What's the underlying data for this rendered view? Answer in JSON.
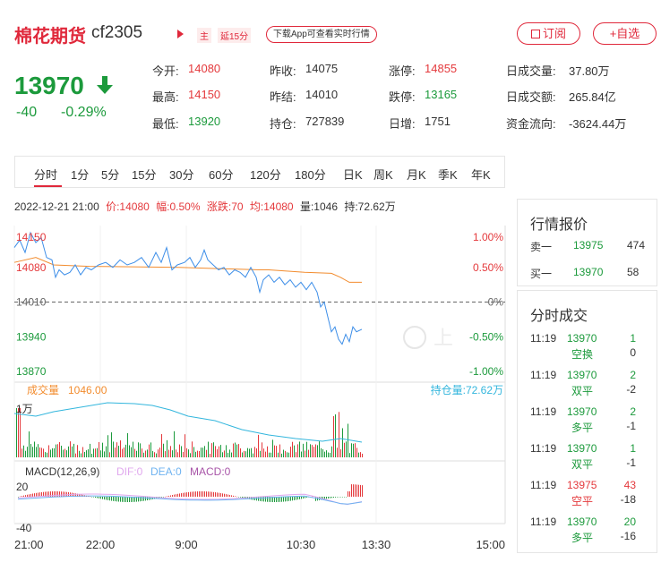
{
  "header": {
    "name": "棉花期货",
    "code": "cf2305",
    "main_tag": "主",
    "delay_tag": "延15分",
    "download": "下载App可查看实时行情",
    "subscribe": "订阅",
    "watch": "+自选"
  },
  "quote": {
    "price": "13970",
    "change": "-40",
    "change_pct": "-0.29%",
    "fields": [
      {
        "label": "今开:",
        "value": "14080",
        "tone": "red"
      },
      {
        "label": "昨收:",
        "value": "14075",
        "tone": "normal"
      },
      {
        "label": "涨停:",
        "value": "14855",
        "tone": "red"
      },
      {
        "label": "日成交量:",
        "value": "37.80万",
        "tone": "normal"
      },
      {
        "label": "最高:",
        "value": "14150",
        "tone": "red"
      },
      {
        "label": "昨结:",
        "value": "14010",
        "tone": "normal"
      },
      {
        "label": "跌停:",
        "value": "13165",
        "tone": "green"
      },
      {
        "label": "日成交额:",
        "value": "265.84亿",
        "tone": "normal"
      },
      {
        "label": "最低:",
        "value": "13920",
        "tone": "green"
      },
      {
        "label": "持仓:",
        "value": "727839",
        "tone": "normal"
      },
      {
        "label": "日增:",
        "value": "1751",
        "tone": "normal"
      },
      {
        "label": "资金流向:",
        "value": "-3624.44万",
        "tone": "normal"
      }
    ]
  },
  "tabs": [
    "分时",
    "1分",
    "5分",
    "15分",
    "30分",
    "60分",
    "120分",
    "180分",
    "日K",
    "周K",
    "月K",
    "季K",
    "年K"
  ],
  "active_tab": "分时",
  "info_line": {
    "datetime": "2022-12-21 21:00",
    "price": "价:14080",
    "amplitude": "幅:0.50%",
    "change": "涨跌:70",
    "avg": "均:14080",
    "volume": "量:1046",
    "open_interest": "持:72.62万"
  },
  "chart": {
    "price_ticks": [
      "14150",
      "14080",
      "14010",
      "13940",
      "13870"
    ],
    "pct_ticks": [
      "1.00%",
      "0.50%",
      "0%",
      "-0.50%",
      "-1.00%"
    ],
    "volume_label": "成交量",
    "volume_value": "1046.00",
    "oi_label": "持仓量:72.62万",
    "volume_tick": "1万",
    "macd_label": "MACD(12,26,9)",
    "dif": "DIF:0",
    "dea": "DEA:0",
    "macd": "MACD:0",
    "macd_top": "20",
    "macd_bottom": "-40",
    "time_ticks": [
      "21:00",
      "22:00",
      "9:00",
      "10:30",
      "13:30",
      "15:00"
    ],
    "colors": {
      "price": "#3d8ee8",
      "avg": "#f28c2e",
      "oi": "#33b6dd",
      "up": "#e4393c",
      "down": "#1c9a3c",
      "dif": "#e0a8ee",
      "dea": "#6fb3f0",
      "macd": "#a855a8"
    }
  },
  "order_book": {
    "title": "行情报价",
    "rows": [
      {
        "side": "卖一",
        "price": "13975",
        "qty": "474"
      },
      {
        "side": "买一",
        "price": "13970",
        "qty": "58"
      }
    ]
  },
  "trades": {
    "title": "分时成交",
    "rows": [
      {
        "time": "11:19",
        "price": "13970",
        "vol": "1",
        "type": "空换",
        "oi": "0",
        "tone": "green"
      },
      {
        "time": "11:19",
        "price": "13970",
        "vol": "2",
        "type": "双平",
        "oi": "-2",
        "tone": "green"
      },
      {
        "time": "11:19",
        "price": "13970",
        "vol": "2",
        "type": "多平",
        "oi": "-1",
        "tone": "green"
      },
      {
        "time": "11:19",
        "price": "13970",
        "vol": "1",
        "type": "双平",
        "oi": "-1",
        "tone": "green"
      },
      {
        "time": "11:19",
        "price": "13975",
        "vol": "43",
        "type": "空平",
        "oi": "-18",
        "tone": "red"
      },
      {
        "time": "11:19",
        "price": "13970",
        "vol": "20",
        "type": "多平",
        "oi": "-16",
        "tone": "green"
      }
    ]
  }
}
